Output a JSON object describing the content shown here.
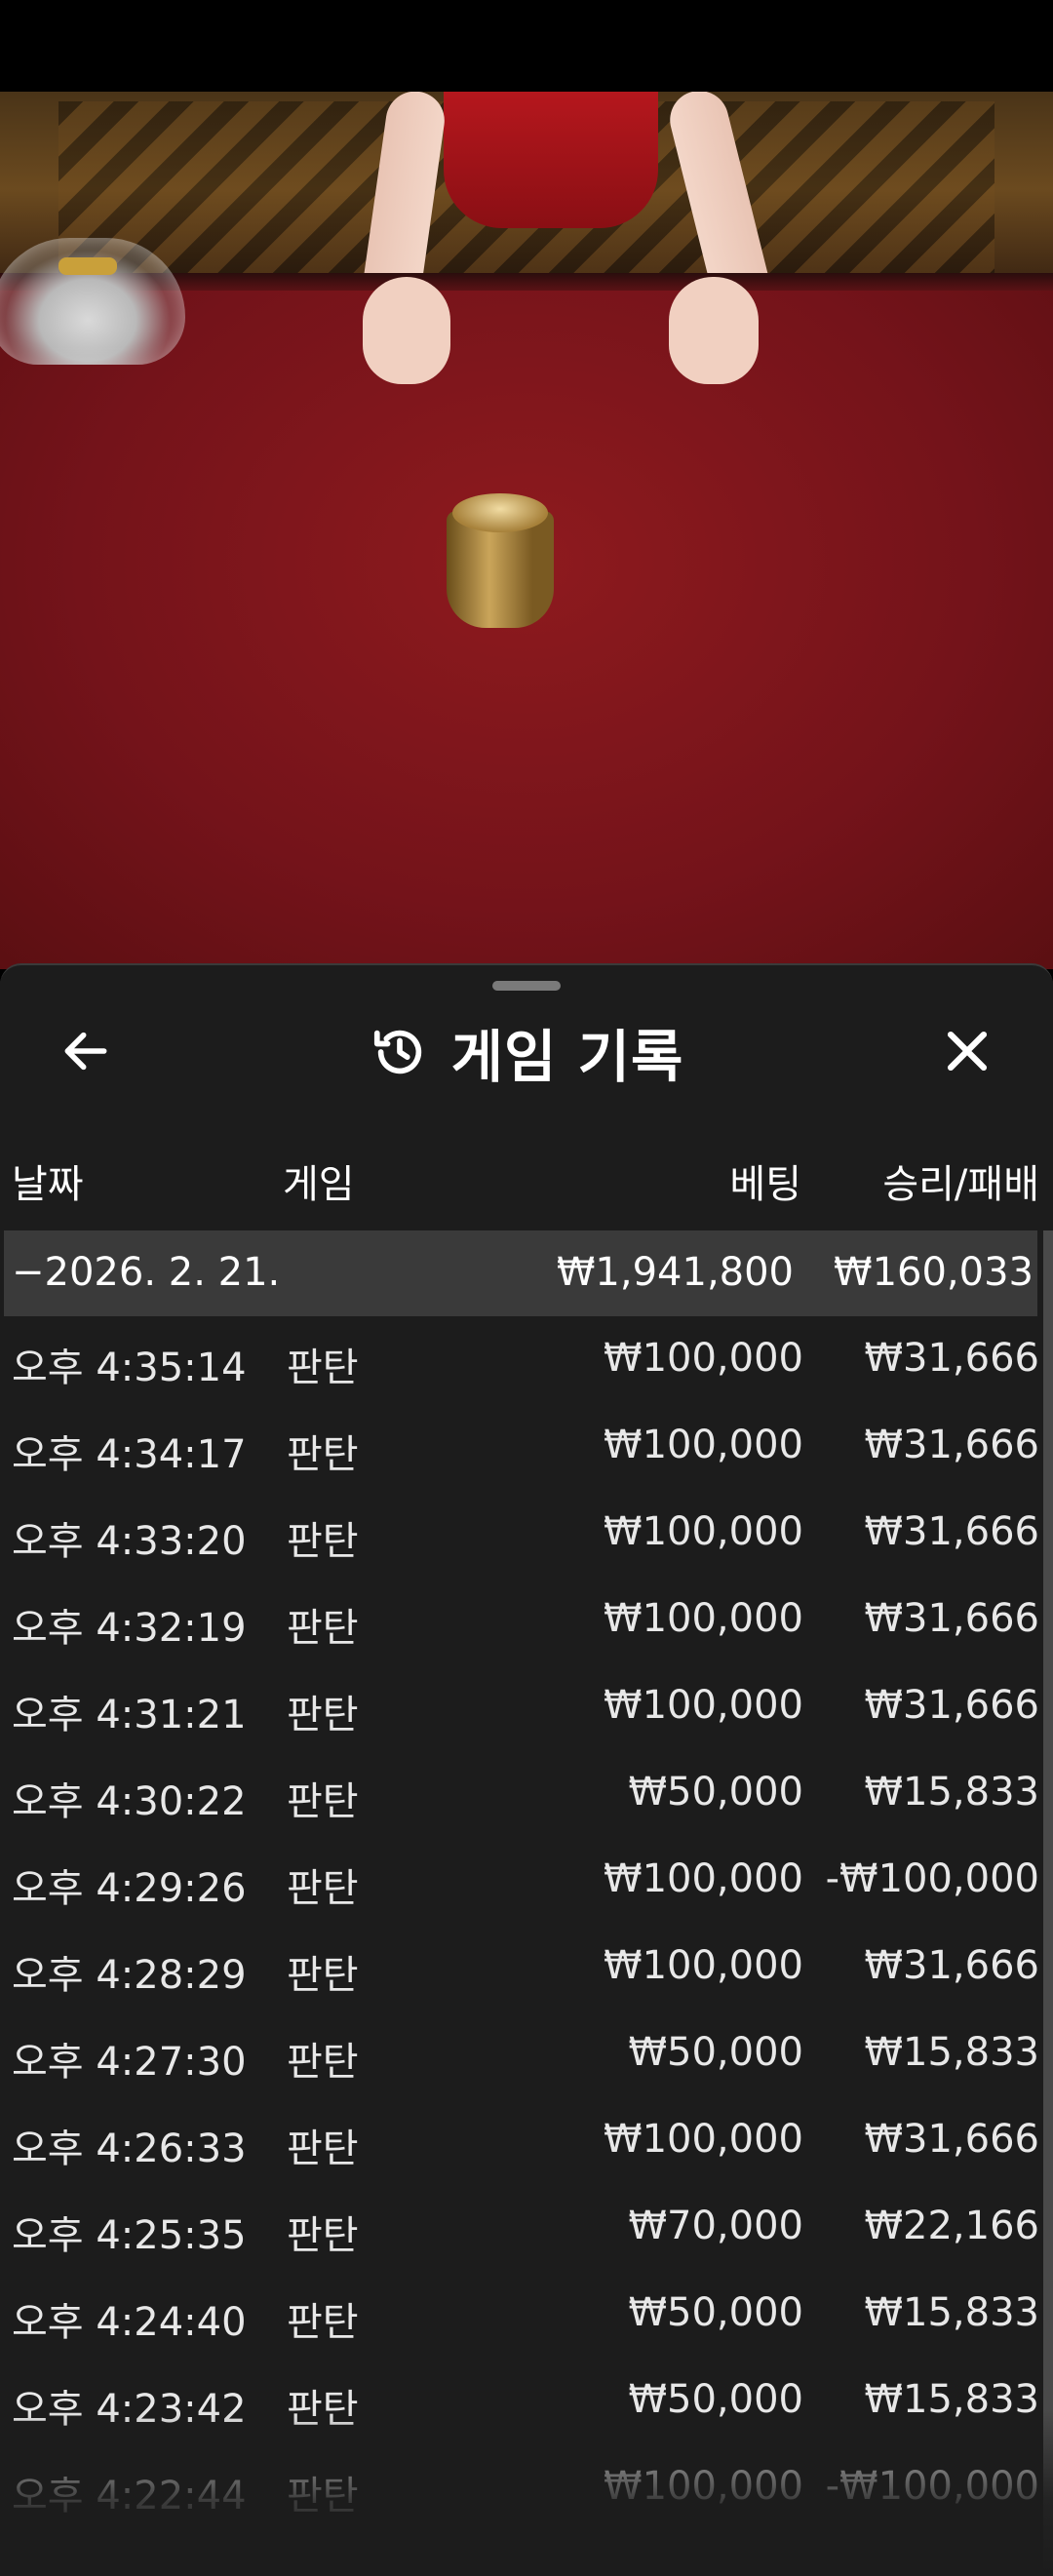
{
  "header": {
    "title": "게임 기록",
    "back_icon": "arrow-left-icon",
    "history_icon": "history-icon",
    "close_icon": "close-icon"
  },
  "columns": {
    "date": "날짜",
    "game": "게임",
    "bet": "베팅",
    "win_loss": "승리/패배"
  },
  "day_group": {
    "date": "−2026. 2. 21.",
    "bet_total": "₩1,941,800",
    "win_total": "₩160,033"
  },
  "rows": [
    {
      "time": "오후 4:35:14",
      "game": "판탄",
      "bet": "₩100,000",
      "win": "₩31,666"
    },
    {
      "time": "오후 4:34:17",
      "game": "판탄",
      "bet": "₩100,000",
      "win": "₩31,666"
    },
    {
      "time": "오후 4:33:20",
      "game": "판탄",
      "bet": "₩100,000",
      "win": "₩31,666"
    },
    {
      "time": "오후 4:32:19",
      "game": "판탄",
      "bet": "₩100,000",
      "win": "₩31,666"
    },
    {
      "time": "오후 4:31:21",
      "game": "판탄",
      "bet": "₩100,000",
      "win": "₩31,666"
    },
    {
      "time": "오후 4:30:22",
      "game": "판탄",
      "bet": "₩50,000",
      "win": "₩15,833"
    },
    {
      "time": "오후 4:29:26",
      "game": "판탄",
      "bet": "₩100,000",
      "win": "-₩100,000"
    },
    {
      "time": "오후 4:28:29",
      "game": "판탄",
      "bet": "₩100,000",
      "win": "₩31,666"
    },
    {
      "time": "오후 4:27:30",
      "game": "판탄",
      "bet": "₩50,000",
      "win": "₩15,833"
    },
    {
      "time": "오후 4:26:33",
      "game": "판탄",
      "bet": "₩100,000",
      "win": "₩31,666"
    },
    {
      "time": "오후 4:25:35",
      "game": "판탄",
      "bet": "₩70,000",
      "win": "₩22,166"
    },
    {
      "time": "오후 4:24:40",
      "game": "판탄",
      "bet": "₩50,000",
      "win": "₩15,833"
    },
    {
      "time": "오후 4:23:42",
      "game": "판탄",
      "bet": "₩50,000",
      "win": "₩15,833"
    },
    {
      "time": "오후 4:22:44",
      "game": "판탄",
      "bet": "₩100,000",
      "win": "-₩100,000"
    }
  ],
  "colors": {
    "sheet_bg": "#1c1c1c",
    "day_row_bg": "#3a3a3a",
    "table_felt": "#8e1a1e"
  }
}
